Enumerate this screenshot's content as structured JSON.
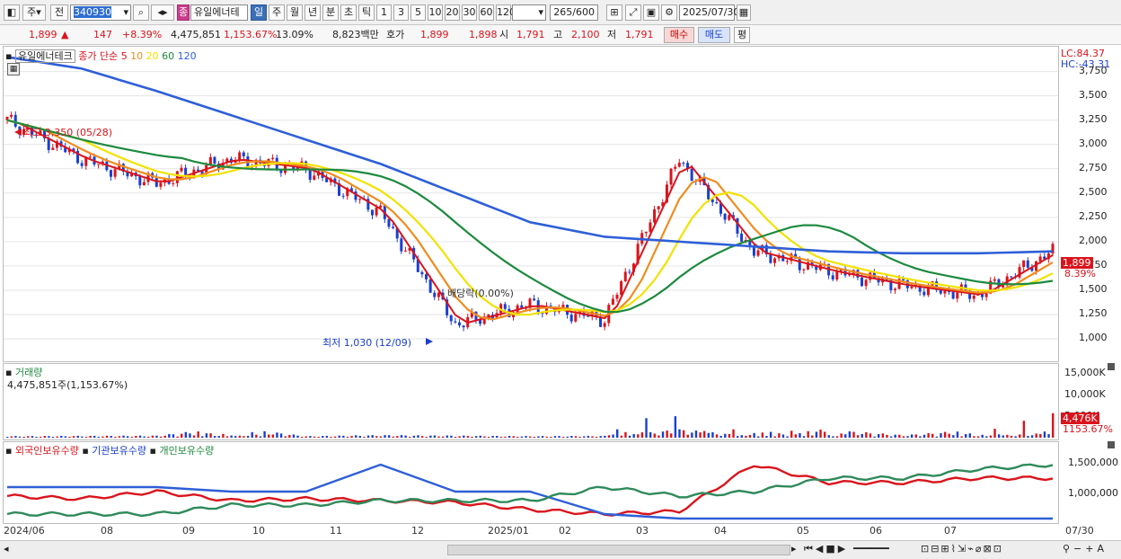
{
  "toolbar": {
    "market_btn": "주",
    "scope_btn": "전",
    "code": "340930",
    "name": "유일에너테",
    "period_tabs": [
      "일",
      "주",
      "월",
      "년",
      "분",
      "초",
      "틱"
    ],
    "active_tab": "일",
    "intervals": [
      "1",
      "3",
      "5",
      "10",
      "20",
      "30",
      "60",
      "120"
    ],
    "count": "265/600",
    "date": "2025/07/30",
    "badge": "종"
  },
  "quote": {
    "price": "1,899",
    "change": "147",
    "change_pct": "+8.39%",
    "volume": "4,475,851",
    "volume_pct": "1,153.67%",
    "turnover": "13.09%",
    "amount": "8,823백만",
    "hoga_label": "호가",
    "ask": "1,899",
    "bid": "1,898",
    "open_label": "시",
    "open": "1,791",
    "high_label": "고",
    "high": "2,100",
    "low_label": "저",
    "low": "1,791",
    "buy": "매수",
    "sell": "매도",
    "avg": "평"
  },
  "price_panel": {
    "stock_name": "유일에너테크",
    "ma_label": "종가 단순",
    "ma_periods": [
      "5",
      "10",
      "20",
      "60",
      "120"
    ],
    "ma_colors": [
      "#d9141c",
      "#f08c1e",
      "#f2e200",
      "#1d8a3e",
      "#2e5fd8"
    ],
    "lc": "LC:84.37",
    "hc": "HC:-43.31",
    "high_note": "최고 3,350 (05/28)",
    "low_note": "최저 1,030 (12/09)",
    "dividend_note": "배당락(0.00%)",
    "y_ticks": [
      "3,750",
      "3,500",
      "3,250",
      "3,000",
      "2,750",
      "2,500",
      "2,250",
      "2,000",
      "1,750",
      "1,500",
      "1,250",
      "1,000"
    ],
    "cur_price": "1,899",
    "cur_pct": "8.39%"
  },
  "volume_panel": {
    "title": "거래량",
    "value": "4,475,851주(1,153.67%)",
    "y_ticks": [
      "15,000K",
      "10,000K",
      "5,000K"
    ],
    "cur": "4,476K",
    "cur_pct": "1153.67%"
  },
  "holding_panel": {
    "legend": [
      "외국인보유수량",
      "기관보유수량",
      "개인보유수량"
    ],
    "colors": [
      "#d9141c",
      "#2e5fd8",
      "#2f8a5a"
    ],
    "y_ticks": [
      "1,500,000",
      "1,000,000"
    ]
  },
  "x_axis": [
    "2024/06",
    "08",
    "09",
    "10",
    "11",
    "12",
    "2025/01",
    "02",
    "03",
    "04",
    "05",
    "06",
    "07",
    "07/30"
  ],
  "chart_data": {
    "type": "candlestick",
    "ylim": [
      880,
      3950
    ],
    "x": [
      "2024/06",
      "07",
      "08",
      "09",
      "10",
      "11",
      "12",
      "2025/01",
      "02",
      "03",
      "04",
      "05",
      "06",
      "07",
      "07/30"
    ],
    "close": [
      3250,
      2850,
      2600,
      2850,
      2750,
      2300,
      1150,
      1350,
      1200,
      2850,
      1900,
      1700,
      1550,
      1450,
      1899
    ],
    "ma120": [
      3900,
      3780,
      3550,
      3300,
      3050,
      2800,
      2500,
      2200,
      2050,
      2000,
      1950,
      1900,
      1880,
      1880,
      1900
    ],
    "volume_k": [
      300,
      350,
      400,
      2000,
      300,
      500,
      400,
      300,
      350,
      8000,
      1200,
      1500,
      500,
      1500,
      4476
    ]
  }
}
